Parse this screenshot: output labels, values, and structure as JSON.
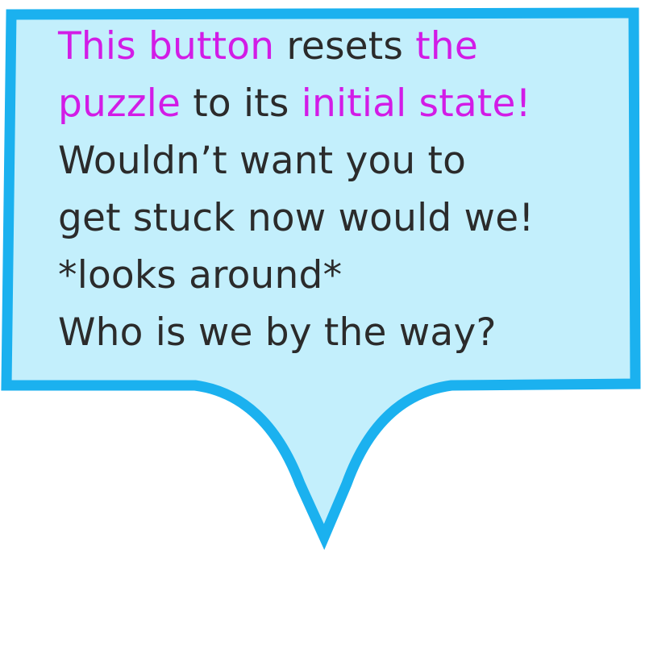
{
  "bubble": {
    "fill_color": "#c3effc",
    "border_color": "#1bb1ef",
    "highlight_color": "#d21ce6",
    "text_color": "#2b2b2b",
    "line1": {
      "part1": "This button",
      "part2": " resets ",
      "part3": "the"
    },
    "line2": {
      "part1": "puzzle",
      "part2": " to its ",
      "part3": "initial state!"
    },
    "line3": "Wouldn’t want you to",
    "line4": "get stuck now would we!",
    "line5": "*looks around*",
    "line6": "Who is we by the way?"
  }
}
